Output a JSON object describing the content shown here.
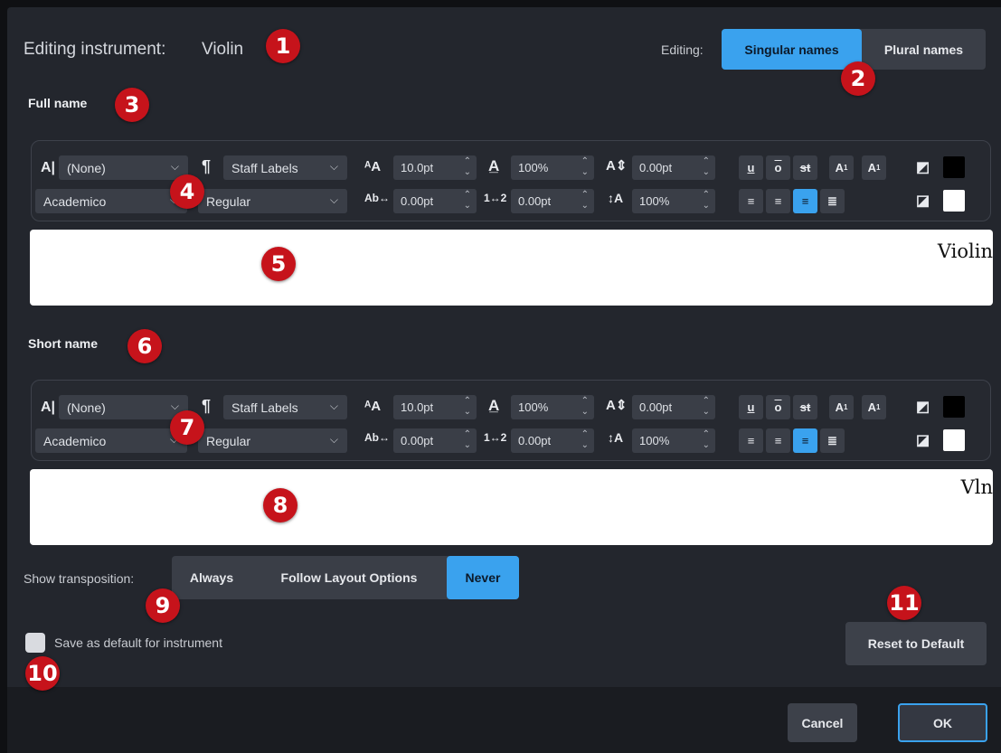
{
  "header": {
    "editing_instrument_label": "Editing instrument:",
    "instrument_name": "Violin",
    "editing_label": "Editing:",
    "singular_names": "Singular names",
    "plural_names": "Plural names"
  },
  "full_name": {
    "section_label": "Full name",
    "editor_text": "Violin"
  },
  "short_name": {
    "section_label": "Short name",
    "editor_text": "Vln"
  },
  "toolbar": {
    "paragraph_style": "(None)",
    "character_style": "Staff Labels",
    "font_family": "Academico",
    "font_style": "Regular",
    "font_size": "10.0pt",
    "width_scale": "100%",
    "baseline_offset": "0.00pt",
    "kerning": "0.00pt",
    "tracking": "0.00pt",
    "height_scale": "100%",
    "underline": "u",
    "overline": "o",
    "strikethrough": "st",
    "superscript": "A",
    "subscript": "A"
  },
  "transposition": {
    "label": "Show transposition:",
    "options": [
      "Always",
      "Follow Layout Options",
      "Never"
    ],
    "selected": "Never"
  },
  "save_default_label": "Save as default for instrument",
  "reset_label": "Reset to Default",
  "footer": {
    "cancel": "Cancel",
    "ok": "OK"
  },
  "callouts": [
    "1",
    "2",
    "3",
    "4",
    "5",
    "6",
    "7",
    "8",
    "9",
    "10",
    "11"
  ],
  "colors": {
    "accent": "#3aa2ee",
    "badge": "#c6131b",
    "text_color": "#000000",
    "background_color": "#ffffff"
  }
}
